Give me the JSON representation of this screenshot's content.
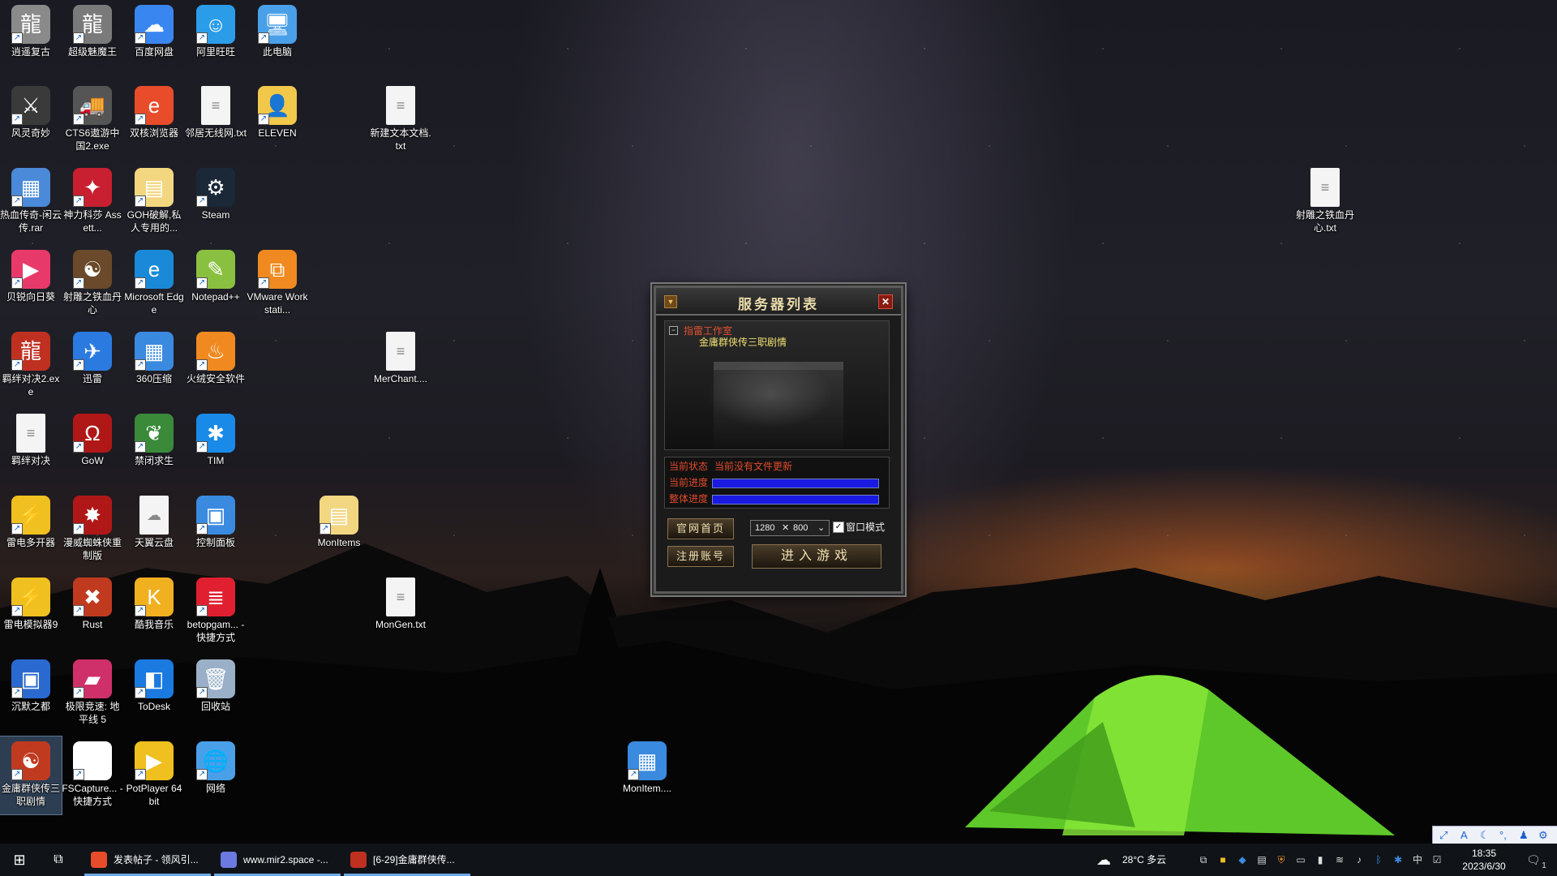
{
  "desktop_icons": [
    {
      "label": "逍遥复古",
      "glyph": "龍",
      "color": "#8a8a8a"
    },
    {
      "label": "超级魅魔王",
      "glyph": "龍",
      "color": "#7a7a7a"
    },
    {
      "label": "百度网盘",
      "glyph": "☁",
      "color": "#3a86f0"
    },
    {
      "label": "阿里旺旺",
      "glyph": "☺",
      "color": "#2b9de8"
    },
    {
      "label": "此电脑",
      "glyph": "🖥",
      "color": "#4aa0e8"
    },
    {
      "label": "风灵奇妙",
      "glyph": "⚔",
      "color": "#3a3a3a"
    },
    {
      "label": "CTS6遨游中国2.exe",
      "glyph": "🚚",
      "color": "#555"
    },
    {
      "label": "双核浏览器",
      "glyph": "e",
      "color": "#e94c2a"
    },
    {
      "label": "邻居无线网.txt",
      "glyph": "≡",
      "color": "#f4f4f4"
    },
    {
      "label": "ELEVEN",
      "glyph": "👤",
      "color": "#f2c84b"
    },
    {
      "label": "新建文本文档.txt",
      "glyph": "≡",
      "color": "#f4f4f4"
    },
    {
      "label": "热血传奇-闲云传.rar",
      "glyph": "▦",
      "color": "#4a8ad8"
    },
    {
      "label": "神力科莎 Assett...",
      "glyph": "✦",
      "color": "#c82030"
    },
    {
      "label": "GOH破解,私人专用的...",
      "glyph": "▤",
      "color": "#f2d680"
    },
    {
      "label": "Steam",
      "glyph": "⚙",
      "color": "#1b2838"
    },
    {
      "label": "射雕之铁血丹心.txt",
      "glyph": "≡",
      "color": "#f4f4f4"
    },
    {
      "label": "贝锐向日葵",
      "glyph": "▶",
      "color": "#e83a6a"
    },
    {
      "label": "射雕之铁血丹心",
      "glyph": "☯",
      "color": "#6a4a2a"
    },
    {
      "label": "Microsoft Edge",
      "glyph": "e",
      "color": "#1a8ad8"
    },
    {
      "label": "Notepad++",
      "glyph": "✎",
      "color": "#8ac040"
    },
    {
      "label": "VMware Workstati...",
      "glyph": "⧉",
      "color": "#f08a20"
    },
    {
      "label": "羁绊对决2.exe",
      "glyph": "龍",
      "color": "#c03020"
    },
    {
      "label": "迅雷",
      "glyph": "✈",
      "color": "#2a7ae0"
    },
    {
      "label": "360压缩",
      "glyph": "▦",
      "color": "#3a8ae0"
    },
    {
      "label": "火绒安全软件",
      "glyph": "♨",
      "color": "#f08a20"
    },
    {
      "label": "MerChant....",
      "glyph": "≡",
      "color": "#f4f4f4"
    },
    {
      "label": "羁绊对决",
      "glyph": "≡",
      "color": "#f4f4f4"
    },
    {
      "label": "GoW",
      "glyph": "Ω",
      "color": "#b01818"
    },
    {
      "label": "禁闭求生",
      "glyph": "❦",
      "color": "#3a8a3a"
    },
    {
      "label": "TIM",
      "glyph": "✱",
      "color": "#1a8ae8"
    },
    {
      "label": "雷电多开器",
      "glyph": "⚡",
      "color": "#f0c020"
    },
    {
      "label": "漫威蜘蛛侠重制版",
      "glyph": "✸",
      "color": "#b01818"
    },
    {
      "label": "天翼云盘",
      "glyph": "☁",
      "color": "#f4f4f4"
    },
    {
      "label": "控制面板",
      "glyph": "▣",
      "color": "#3a8ae0"
    },
    {
      "label": "MonItems",
      "glyph": "▤",
      "color": "#f2d680"
    },
    {
      "label": "雷电模拟器9",
      "glyph": "⚡",
      "color": "#f0c020"
    },
    {
      "label": "Rust",
      "glyph": "✖",
      "color": "#c03a20"
    },
    {
      "label": "酷我音乐",
      "glyph": "K",
      "color": "#f0b020"
    },
    {
      "label": "betopgam... - 快捷方式",
      "glyph": "≣",
      "color": "#e02030"
    },
    {
      "label": "MonGen.txt",
      "glyph": "≡",
      "color": "#f4f4f4"
    },
    {
      "label": "沉默之都",
      "glyph": "▣",
      "color": "#2a6ad0"
    },
    {
      "label": "极限竞速: 地平线 5",
      "glyph": "▰",
      "color": "#d0306a"
    },
    {
      "label": "ToDesk",
      "glyph": "◧",
      "color": "#1a7ae0"
    },
    {
      "label": "回收站",
      "glyph": "🗑",
      "color": "#9ab0c8"
    },
    {
      "label": "金庸群侠传三职剧情",
      "glyph": "☯",
      "color": "#c03a20"
    },
    {
      "label": "FSCapture... - 快捷方式",
      "glyph": "▬",
      "color": "#ffffff"
    },
    {
      "label": "PotPlayer 64 bit",
      "glyph": "▶",
      "color": "#f0c020"
    },
    {
      "label": "网络",
      "glyph": "🌐",
      "color": "#4aa0e8"
    },
    {
      "label": "MonItem....",
      "glyph": "▦",
      "color": "#3a8ae0"
    }
  ],
  "launcher": {
    "title": "服务器列表",
    "close": "✕",
    "min": "▼",
    "group": "指雷工作室",
    "server": "金庸群侠传三职剧情",
    "status_label": "当前状态",
    "status_value": "当前没有文件更新",
    "current_progress_label": "当前进度",
    "current_progress": 1.0,
    "total_progress_label": "整体进度",
    "total_progress": 1.0,
    "home_button": "官网首页",
    "register_button": "注册账号",
    "enter_button": "进入游戏",
    "res_w": "1280",
    "res_x": "✕",
    "res_h": "800",
    "window_mode_label": "窗口模式",
    "window_mode_checked": true
  },
  "taskbar": {
    "apps": [
      {
        "label": "发表帖子 - 领风引...",
        "color": "#e94c2a"
      },
      {
        "label": "www.mir2.space -...",
        "color": "#6a7ae0"
      },
      {
        "label": "[6-29]金庸群侠传...",
        "color": "#c03020"
      }
    ],
    "weather": "28°C 多云",
    "ime": "中",
    "time": "18:35",
    "date": "2023/6/30",
    "notif_count": "1"
  },
  "ime_bar": {
    "a": "A"
  }
}
